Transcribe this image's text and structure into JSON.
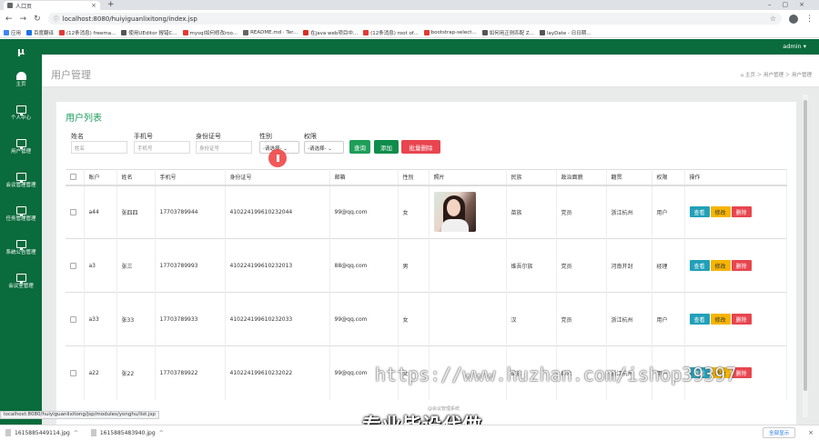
{
  "browser": {
    "tab_title": "人口页",
    "url": "localhost:8080/huiyiguanlixitong/index.jsp",
    "bookmarks": [
      "应用",
      "百度翻译",
      "(12条消息) freema...",
      "使用UEditor 报错C...",
      "mysql如何修改roo...",
      "README.md · Ter...",
      "在java web项目中...",
      "(12条消息) root of...",
      "bootstrap-select...",
      "如何用正则匹配 Z...",
      "layDate - 日日期..."
    ],
    "status_url": "localhost:8080/huiyiguanlixitong/jsp/modules/yonghu/list.jsp"
  },
  "sidebar": {
    "logo": "μ",
    "items": [
      {
        "label": "主页",
        "icon": "home-icon"
      },
      {
        "label": "个人中心",
        "icon": "monitor-icon"
      },
      {
        "label": "用户管理",
        "icon": "monitor-icon"
      },
      {
        "label": "会议管理管理",
        "icon": "monitor-icon"
      },
      {
        "label": "任务管理管理",
        "icon": "monitor-icon"
      },
      {
        "label": "系统公告管理",
        "icon": "monitor-icon"
      },
      {
        "label": "会议室管理",
        "icon": "monitor-icon"
      }
    ]
  },
  "topbar": {
    "user": "admin ▾"
  },
  "page": {
    "title": "用户管理",
    "breadcrumb": "⌂ 主页 ＞ 用户管理 ＞ 用户管理",
    "panel_title": "用户列表"
  },
  "search": {
    "name_label": "姓名",
    "name_placeholder": "姓名",
    "phone_label": "手机号",
    "phone_placeholder": "手机号",
    "idcard_label": "身份证号",
    "idcard_placeholder": "身份证号",
    "gender_label": "性别",
    "gender_value": "-请选择-",
    "role_label": "权限",
    "role_value": "-请选择-",
    "query": "查询",
    "add": "添加",
    "batch_delete": "批量删除"
  },
  "table": {
    "headers": [
      "账户",
      "姓名",
      "手机号",
      "身份证号",
      "邮箱",
      "性别",
      "照片",
      "民族",
      "政治面貌",
      "籍贯",
      "权限",
      "操作"
    ],
    "rows": [
      [
        "a44",
        "张四四",
        "17703789944",
        "410224199610232044",
        "99@qq.com",
        "女",
        "",
        "苗族",
        "党员",
        "浙江杭州",
        "用户"
      ],
      [
        "a3",
        "张三",
        "17703789993",
        "410224199610232013",
        "88@qq.com",
        "男",
        "",
        "维吾尔族",
        "党员",
        "河南开封",
        "经理"
      ],
      [
        "a33",
        "张33",
        "17703789933",
        "410224199610232033",
        "99@qq.com",
        "女",
        "",
        "汉",
        "党员",
        "浙江杭州",
        "用户"
      ],
      [
        "a22",
        "张22",
        "17703789922",
        "410224199610232022",
        "99@qq.com",
        "女",
        "",
        "苗族",
        "群众",
        "浙江杭州",
        "用户"
      ]
    ],
    "op_view": "查看",
    "op_edit": "修改",
    "op_delete": "删除"
  },
  "overlay": {
    "watermark": "https://www.huzhan.com/ishop39397",
    "caption": "专业毕设代做",
    "footnote": "@会议管理系统"
  },
  "downloads": {
    "files": [
      "1615885449114.jpg",
      "1615885483940.jpg"
    ],
    "show_all": "全部显示"
  }
}
